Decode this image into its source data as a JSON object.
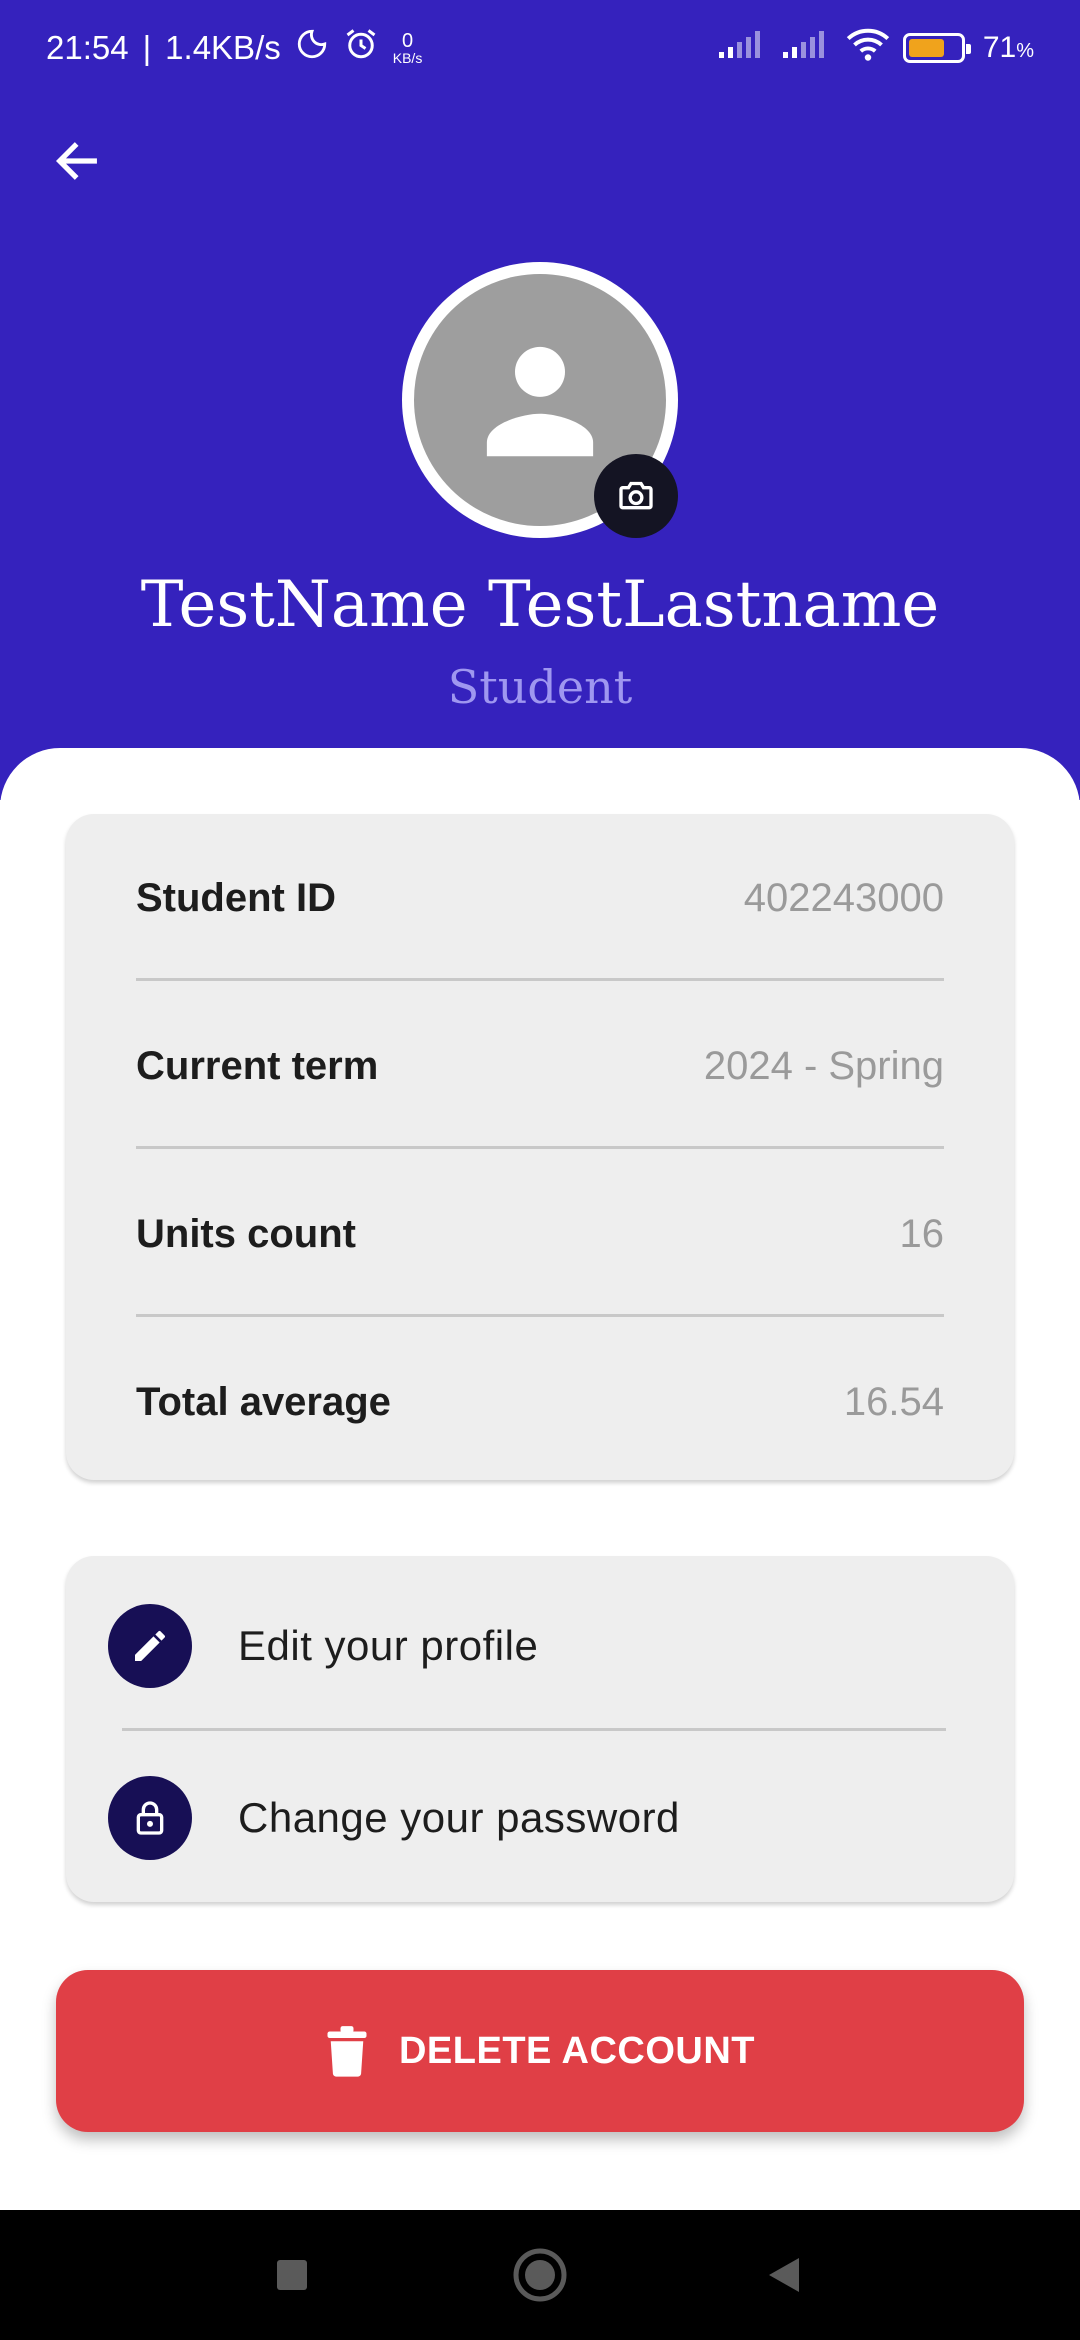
{
  "status_bar": {
    "time": "21:54",
    "speed": "1.4KB/s",
    "separator": "|",
    "net_rate_value": "0",
    "net_rate_unit": "KB/s",
    "battery_percent": "71",
    "battery_unit": "%",
    "battery_level": 0.71,
    "icons": [
      "moon-icon",
      "alarm-icon",
      "signal-icon",
      "signal-icon",
      "wifi-icon",
      "battery-icon"
    ]
  },
  "header": {
    "background_color": "#3522bd",
    "back_icon": "arrow-left-icon",
    "camera_icon": "camera-icon"
  },
  "profile": {
    "name": "TestName TestLastname",
    "role": "Student"
  },
  "info_card": {
    "rows": [
      {
        "label": "Student ID",
        "value": "402243000"
      },
      {
        "label": "Current term",
        "value": "2024 - Spring"
      },
      {
        "label": "Units count",
        "value": "16"
      },
      {
        "label": "Total average",
        "value": "16.54"
      }
    ]
  },
  "actions": {
    "items": [
      {
        "label": "Edit your profile",
        "icon": "pencil-icon"
      },
      {
        "label": "Change your password",
        "icon": "lock-icon"
      }
    ]
  },
  "delete_button": {
    "label": "DELETE ACCOUNT",
    "icon": "trash-icon",
    "color": "#e03f46"
  },
  "nav_bar": {
    "icons": [
      "recents-square-icon",
      "home-circle-icon",
      "back-triangle-icon"
    ]
  }
}
